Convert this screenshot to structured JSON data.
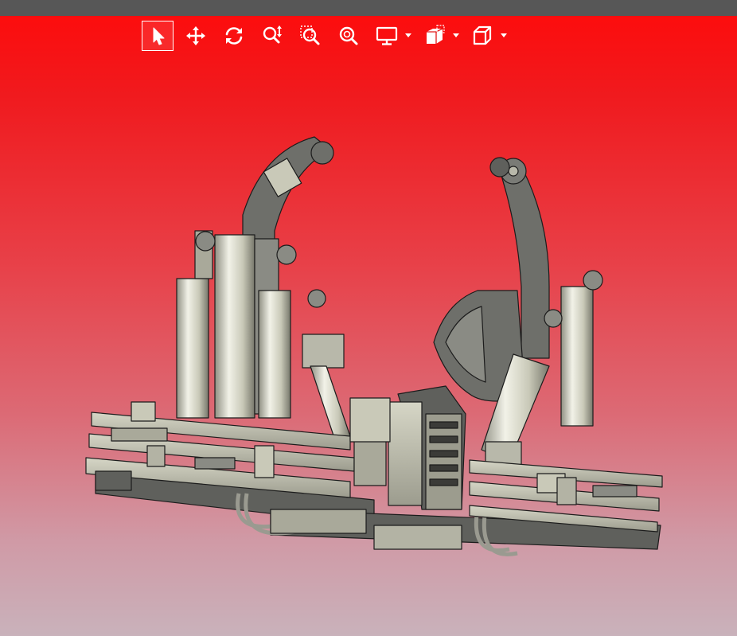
{
  "toolbar": {
    "buttons": [
      {
        "id": "select",
        "icon": "cursor-arrow-icon",
        "active": true
      },
      {
        "id": "pan",
        "icon": "move-arrows-icon"
      },
      {
        "id": "rotate",
        "icon": "rotate-icon"
      },
      {
        "id": "zoom",
        "icon": "zoom-vertical-icon"
      },
      {
        "id": "zoom-window",
        "icon": "zoom-window-icon"
      },
      {
        "id": "zoom-fit",
        "icon": "zoom-fit-icon"
      },
      {
        "id": "display-mode",
        "icon": "monitor-icon",
        "dropdown": true
      },
      {
        "id": "section",
        "icon": "section-cut-icon",
        "dropdown": true
      },
      {
        "id": "view-orientation",
        "icon": "cube-view-icon",
        "dropdown": true
      }
    ]
  },
  "colors": {
    "topbar": "#575757",
    "background_top": "#ff0a0a",
    "background_bottom": "#c9b2bb",
    "model_dark": "#5f605c",
    "model_light": "#c9c9b8",
    "model_edge": "#1c1c1c"
  }
}
